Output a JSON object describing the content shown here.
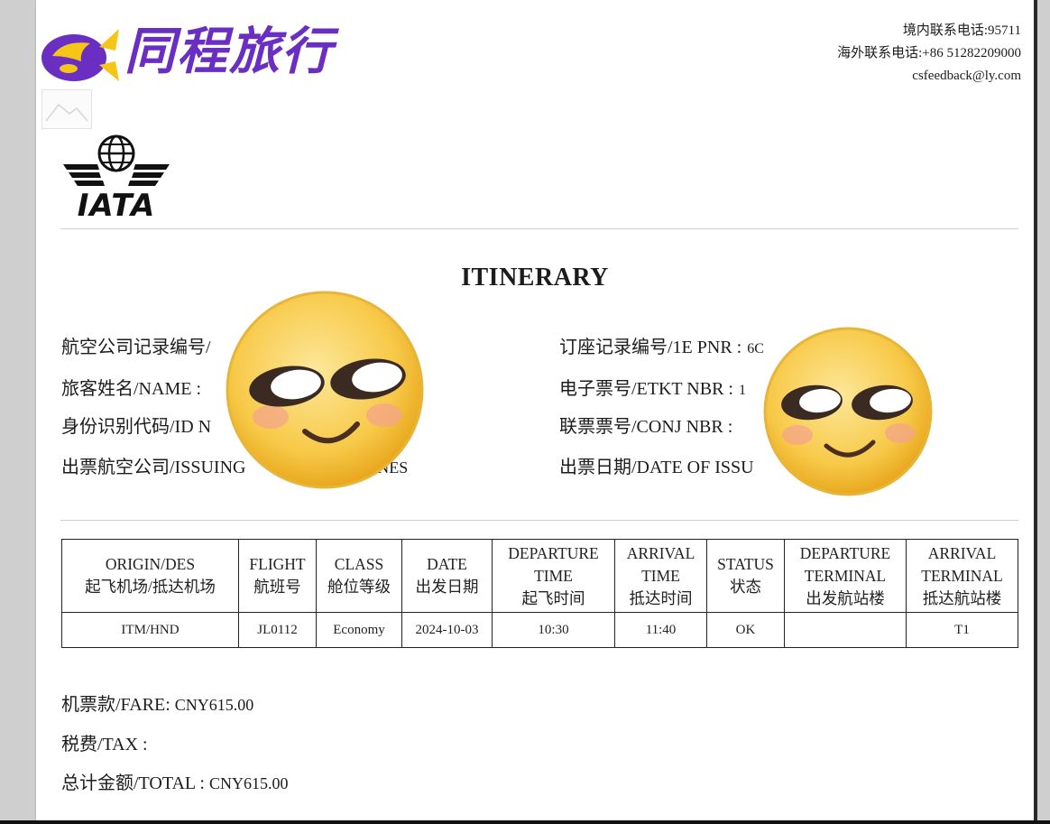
{
  "brand": {
    "name": "同程旅行"
  },
  "contact": {
    "domestic_phone": "境内联系电话:95711",
    "overseas_phone": "海外联系电话:+86 51282209000",
    "email": "csfeedback@ly.com"
  },
  "iata_logo": {
    "text": "IATA",
    "icon": "globe-wings-icon"
  },
  "title": "ITINERARY",
  "fields_left": [
    {
      "label": "航空公司记录编号/",
      "value": "ZA"
    },
    {
      "label": "旅客姓名/NAME :",
      "value": ""
    },
    {
      "label": "身份识别代码/ID N",
      "value": ""
    },
    {
      "label": "出票航空公司/ISSUING",
      "value": "PAN AIRLINES"
    }
  ],
  "fields_right": [
    {
      "label": "订座记录编号/1E PNR :",
      "value": "6C"
    },
    {
      "label": "电子票号/ETKT NBR :",
      "value": "1"
    },
    {
      "label": "联票票号/CONJ NBR :",
      "value": ""
    },
    {
      "label": "出票日期/DATE OF ISSU",
      "value": ""
    }
  ],
  "table": {
    "headers": [
      [
        "ORIGIN/DES",
        "起飞机场/抵达机场"
      ],
      [
        "FLIGHT",
        "航班号"
      ],
      [
        "CLASS",
        "舱位等级"
      ],
      [
        "DATE",
        "出发日期"
      ],
      [
        "DEPARTURE",
        "TIME",
        "起飞时间"
      ],
      [
        "ARRIVAL",
        "TIME",
        "抵达时间"
      ],
      [
        "STATUS",
        "状态"
      ],
      [
        "DEPARTURE",
        "TERMINAL",
        "出发航站楼"
      ],
      [
        "ARRIVAL",
        "TERMINAL",
        "抵达航站楼"
      ]
    ],
    "rows": [
      [
        "ITM/HND",
        "JL0112",
        "Economy",
        "2024-10-03",
        "10:30",
        "11:40",
        "OK",
        "",
        "T1"
      ]
    ]
  },
  "fare": {
    "label": "机票款/FARE:",
    "value": "CNY615.00"
  },
  "tax": {
    "label": "税费/TAX :",
    "value": ""
  },
  "total": {
    "label": "总计金额/TOTAL :",
    "value": "CNY615.00"
  },
  "overlays": [
    "smiling-emoji-icon",
    "smiling-emoji-icon"
  ],
  "colors": {
    "brand_purple": "#6a2fc2",
    "brand_yellow": "#f5c518",
    "emoji_yellow": "#f7c948"
  }
}
